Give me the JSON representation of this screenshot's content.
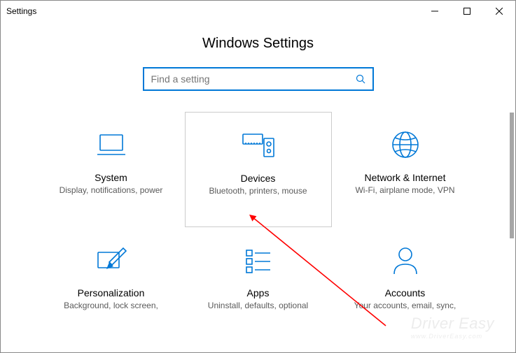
{
  "window": {
    "title": "Settings"
  },
  "header": {
    "page_title": "Windows Settings"
  },
  "search": {
    "placeholder": "Find a setting"
  },
  "tiles": {
    "system": {
      "title": "System",
      "sub": "Display, notifications, power"
    },
    "devices": {
      "title": "Devices",
      "sub": "Bluetooth, printers, mouse"
    },
    "network": {
      "title": "Network & Internet",
      "sub": "Wi-Fi, airplane mode, VPN"
    },
    "personal": {
      "title": "Personalization",
      "sub": "Background, lock screen,"
    },
    "apps": {
      "title": "Apps",
      "sub": "Uninstall, defaults, optional"
    },
    "accounts": {
      "title": "Accounts",
      "sub": "Your accounts, email, sync,"
    }
  },
  "watermark": {
    "brand": "Driver Easy",
    "url": "www.DriverEasy.com"
  },
  "colors": {
    "accent": "#0078d7"
  }
}
